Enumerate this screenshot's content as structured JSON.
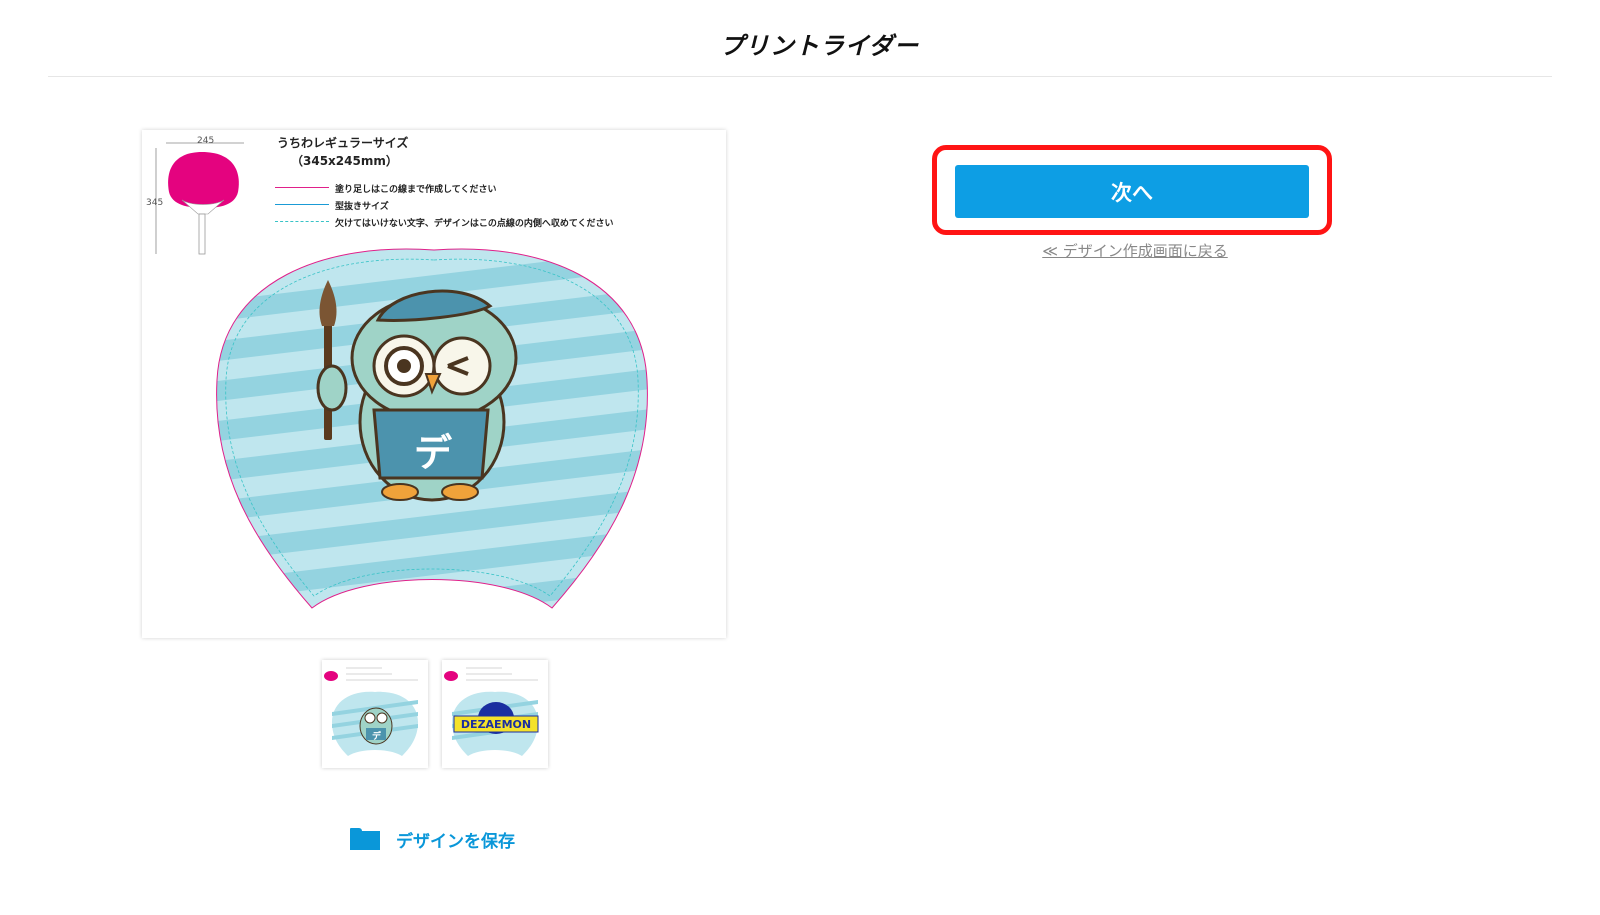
{
  "header": {
    "logo": "プリントライダー"
  },
  "preview": {
    "spec_title": "うちわレギュラーサイズ",
    "spec_size": "（345x245mm）",
    "dim_width": "245",
    "dim_height": "345",
    "legend": [
      {
        "text": "塗り足しはこの線まで作成してください",
        "color": "#e0208a"
      },
      {
        "text": "型抜きサイズ",
        "color": "#1a9bd6"
      },
      {
        "text": "欠けてはいけない文字、デザインはこの点線の内側へ収めてください",
        "color": "#39c3c7"
      }
    ],
    "apron_text": "デ",
    "colors": {
      "fan_front": "#e4037f",
      "stripe_light": "#bfe6ee",
      "stripe_dark": "#94d3e0"
    }
  },
  "thumbnails": [
    {
      "label": "デ"
    },
    {
      "label": "DEZAEMON"
    }
  ],
  "actions": {
    "save_label": "デザインを保存",
    "next_label": "次へ",
    "back_label": "≪ デザイン作成画面に戻る"
  },
  "colors": {
    "accent": "#0d9ee4",
    "highlight": "#ff1414"
  }
}
